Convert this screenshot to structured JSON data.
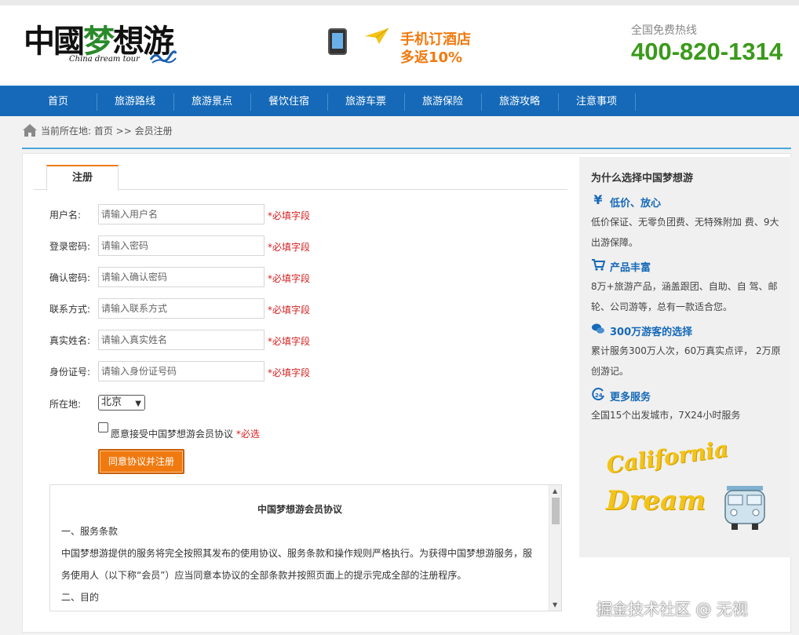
{
  "header": {
    "logo_cn_black": "中國",
    "logo_cn_green": "梦",
    "logo_cn_rest": "想游",
    "logo_en": "China dream tour",
    "promo_line1": "手机订酒店",
    "promo_line2": "多返10%",
    "hotline_label": "全国免费热线",
    "hotline_number": "400-820-1314"
  },
  "nav": {
    "items": [
      "首页",
      "旅游路线",
      "旅游景点",
      "餐饮住宿",
      "旅游车票",
      "旅游保险",
      "旅游攻略",
      "注意事项"
    ]
  },
  "breadcrumb": {
    "text": "当前所在地: 首页 >> 会员注册"
  },
  "form": {
    "tab": "注册",
    "fields": [
      {
        "label": "用户名:",
        "placeholder": "请输入用户名",
        "required": "*必填字段"
      },
      {
        "label": "登录密码:",
        "placeholder": "请输入密码",
        "required": "*必填字段"
      },
      {
        "label": "确认密码:",
        "placeholder": "请输入确认密码",
        "required": "*必填字段"
      },
      {
        "label": "联系方式:",
        "placeholder": "请输入联系方式",
        "required": "*必填字段"
      },
      {
        "label": "真实姓名:",
        "placeholder": "请输入真实姓名",
        "required": "*必填字段"
      },
      {
        "label": "身份证号:",
        "placeholder": "请输入身份证号码",
        "required": "*必填字段"
      }
    ],
    "location_label": "所在地:",
    "location_value": "北京",
    "agree_text": "愿意接受中国梦想游会员协议",
    "agree_required": "*必选",
    "submit_label": "同意协议并注册"
  },
  "agreement": {
    "title": "中国梦想游会员协议",
    "lines": [
      "一、服务条款",
      "中国梦想游提供的服务将完全按照其发布的使用协议、服务条款和操作规则严格执行。为获得中国梦想游服务，服",
      "务使用人（以下称“会员”）应当同意本协议的全部条款并按照页面上的提示完成全部的注册程序。",
      "二、目的"
    ]
  },
  "sidebar": {
    "title": "为什么选择中国梦想游",
    "features": [
      {
        "icon": "yen-icon",
        "label": "低价、放心",
        "desc": "低价保证、无零负团费、无特殊附加 费、9大出游保障。"
      },
      {
        "icon": "cart-icon",
        "label": "产品丰富",
        "desc": "8万+旅游产品，涵盖跟团、自助、自 驾、邮轮、公司游等，总有一款适合您。"
      },
      {
        "icon": "chat-icon",
        "label": "300万游客的选择",
        "desc": "累计服务300万人次，60万真实点评， 2万原创游记。"
      },
      {
        "icon": "service-24-icon",
        "label": "更多服务",
        "desc": "全国15个出发城市，7X24小时服务"
      }
    ],
    "banner_line1": "California",
    "banner_line2": "Dream"
  },
  "watermark": "掘金技术社区 @ 无视",
  "colors": {
    "nav_blue": "#1569b8",
    "accent_orange": "#f07a10",
    "hotline_green": "#3a9a1a",
    "required_red": "#d42020"
  }
}
